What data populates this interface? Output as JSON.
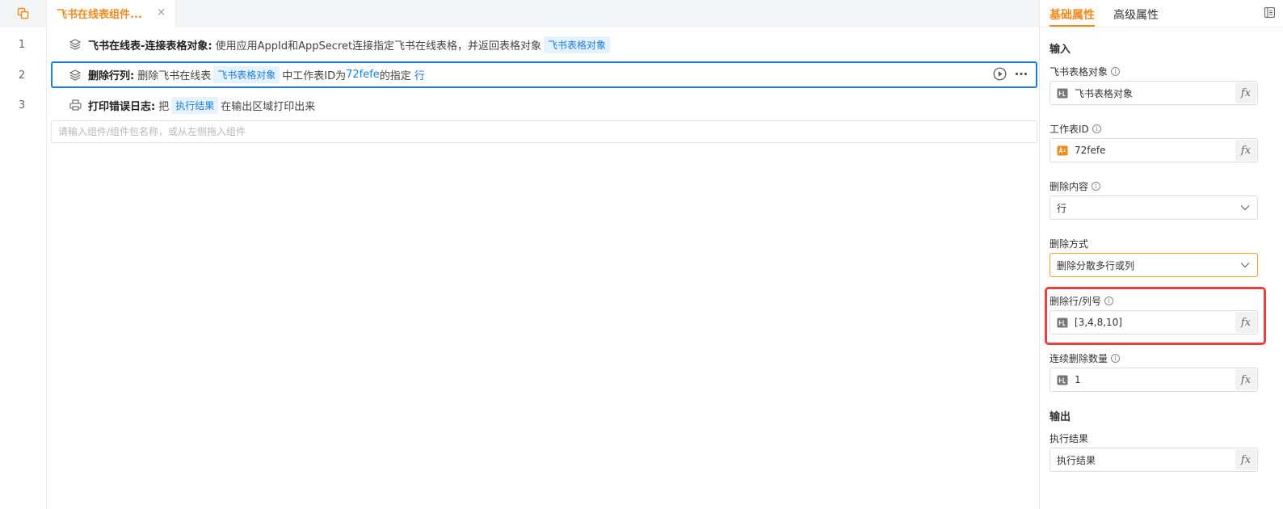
{
  "tab": {
    "title": "飞书在线表组件...",
    "close": "×"
  },
  "lines": [
    {
      "no": "1",
      "title": "飞书在线表-连接表格对象:",
      "text": "使用应用AppId和AppSecret连接指定飞书在线表格，并返回表格对象",
      "chip": "飞书表格对象",
      "icon": "layers-icon"
    },
    {
      "no": "2",
      "title": "删除行列:",
      "text1": "删除飞书在线表",
      "chip": "飞书表格对象",
      "text2": "中工作表ID为",
      "val1": "72fefe",
      "text3": "的指定",
      "val2": "行",
      "icon": "layers-icon"
    },
    {
      "no": "3",
      "title": "打印错误日志:",
      "text1": "把",
      "chip": "执行结果",
      "text2": "在输出区域打印出来",
      "icon": "printer-icon"
    }
  ],
  "command_input": {
    "placeholder": "请输入组件/组件包名称，或从左侧拖入组件",
    "value": ""
  },
  "panel": {
    "tabs": [
      "基础属性",
      "高级属性"
    ],
    "input_title": "输入",
    "output_title": "输出",
    "fields": {
      "sheet_object": {
        "label": "飞书表格对象",
        "value": "飞书表格对象"
      },
      "sheet_id": {
        "label": "工作表ID",
        "value": "72fefe"
      },
      "delete_content": {
        "label": "删除内容",
        "value": "行"
      },
      "delete_mode": {
        "label": "删除方式",
        "value": "删除分散多行或列"
      },
      "row_col_numbers": {
        "label": "删除行/列号",
        "value": "[3,4,8,10]"
      },
      "delete_count": {
        "label": "连续删除数量",
        "value": "1"
      },
      "result": {
        "label": "执行结果",
        "value": "执行结果"
      }
    },
    "fx_label": "fx"
  },
  "colors": {
    "accent": "#f08a1c",
    "link": "#1a7fe0",
    "highlight": "#e8403f"
  }
}
